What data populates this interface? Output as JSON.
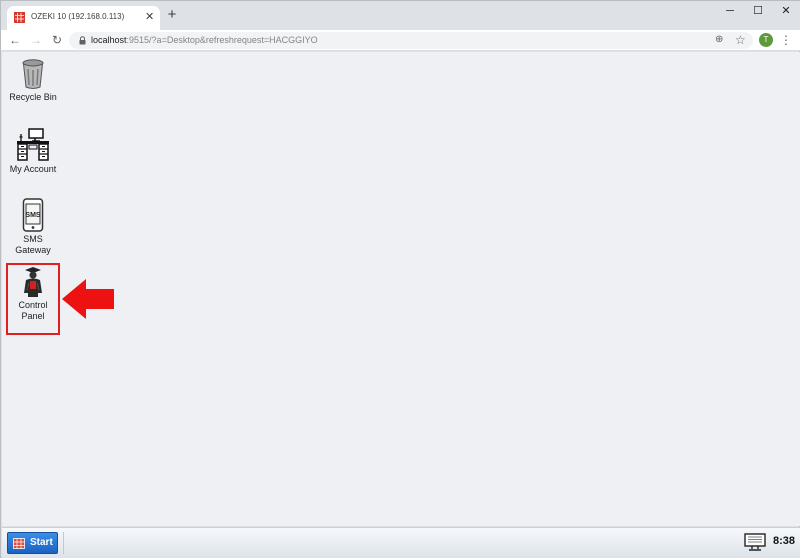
{
  "browser": {
    "tab_title": "OZEKI 10 (192.168.0.113)",
    "tab_close": "✕",
    "new_tab": "+",
    "window_controls": {
      "minimize": "─",
      "maximize": "☐",
      "close": "✕"
    },
    "nav": {
      "back": "←",
      "forward": "→",
      "reload": "↻"
    },
    "url_host": "localhost",
    "url_rest": ":9515/?a=Desktop&refreshrequest=HACGGIYO",
    "zoom_icon": "⊕",
    "bookmark_icon": "☆",
    "profile_initial": "T",
    "menu_icon": "⋮"
  },
  "desktop": {
    "icons": [
      {
        "name": "recycle-bin",
        "label": "Recycle Bin",
        "icon": "trash-can-icon"
      },
      {
        "name": "my-account",
        "label": "My Account",
        "icon": "office-desk-icon"
      },
      {
        "name": "sms-gateway",
        "label_line1": "SMS",
        "label_line2": "Gateway",
        "icon": "sms-phone-icon"
      },
      {
        "name": "control-panel",
        "label_line1": "Control",
        "label_line2": "Panel",
        "icon": "control-panel-person-icon"
      }
    ],
    "annotation": {
      "highlight_color": "#e02020",
      "arrow_color": "#ee1111"
    }
  },
  "taskbar": {
    "start_label": "Start",
    "clock": "8:38"
  },
  "colors": {
    "desktop_bg": "#eef0f4",
    "start_button": "#1f6fd0",
    "chrome_bg": "#dee1e6"
  }
}
